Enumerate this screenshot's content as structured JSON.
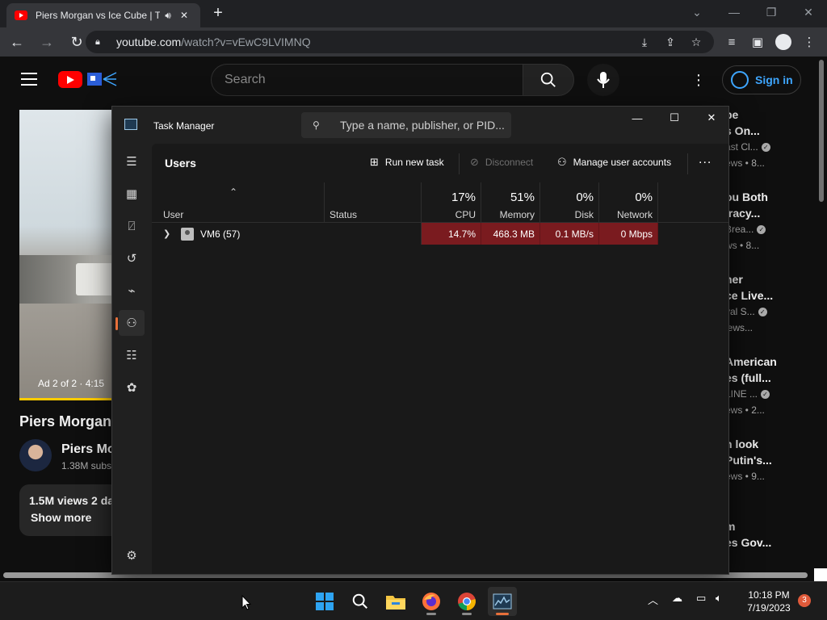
{
  "browser": {
    "tab_title": "Piers Morgan vs Ice Cube | T",
    "new_tab": "+",
    "url_host": "youtube.com",
    "url_path": "/watch?v=vEwC9LVIMNQ"
  },
  "youtube": {
    "search_placeholder": "Search",
    "sign_in": "Sign in",
    "ad_label": "Ad 2 of 2 · 4:15",
    "video_title": "Piers Morgan",
    "channel_name": "Piers Mo",
    "channel_subs": "1.38M subs",
    "views_line": "1.5M views  2 da",
    "show_more": "Show more",
    "recommendations": [
      {
        "l1": "be",
        "l2": "s On...",
        "l3": "ast Cl...",
        "l4": "ews • 8...",
        "verified": true
      },
      {
        "l1": "ou Both",
        "l2": "iracy...",
        "l3": "Brea...",
        "l4": "ws • 8...",
        "verified": true
      },
      {
        "l1": "ner",
        "l2": "ce Live...",
        "l3": "yal S...",
        "l4": "iews...",
        "verified": true
      },
      {
        "l1": "American",
        "l2": "es (full...",
        "l3": "LINE ...",
        "l4": "ews • 2...",
        "verified": true
      },
      {
        "l1": "n look",
        "l2": "Putin's...",
        "l3": "",
        "l4": "ews • 9...",
        "verified": false
      },
      {
        "l1": "m",
        "l2": "es Gov...",
        "l3": "",
        "l4": "",
        "verified": false
      }
    ]
  },
  "task_manager": {
    "title": "Task Manager",
    "search_placeholder": "Type a name, publisher, or PID...",
    "page_title": "Users",
    "commands": {
      "run_new_task": "Run new task",
      "disconnect": "Disconnect",
      "manage_accounts": "Manage user accounts",
      "more": "..."
    },
    "columns": {
      "user": "User",
      "status": "Status",
      "cpu_pct": "17%",
      "cpu": "CPU",
      "memory_pct": "51%",
      "memory": "Memory",
      "disk_pct": "0%",
      "disk": "Disk",
      "network_pct": "0%",
      "network": "Network"
    },
    "rows": [
      {
        "user": "VM6 (57)",
        "status": "",
        "cpu": "14.7%",
        "memory": "468.3 MB",
        "disk": "0.1 MB/s",
        "network": "0 Mbps"
      }
    ],
    "sidebar_icons": [
      "hamburger-icon",
      "processes-icon",
      "performance-icon",
      "app-history-icon",
      "startup-apps-icon",
      "users-icon",
      "details-icon",
      "services-icon",
      "settings-icon"
    ],
    "active_page": "users",
    "accent_color": "#e8703a",
    "heat_color": "#7a1b1f"
  },
  "taskbar": {
    "time": "10:18 PM",
    "date": "7/19/2023",
    "notification_count": "3"
  }
}
